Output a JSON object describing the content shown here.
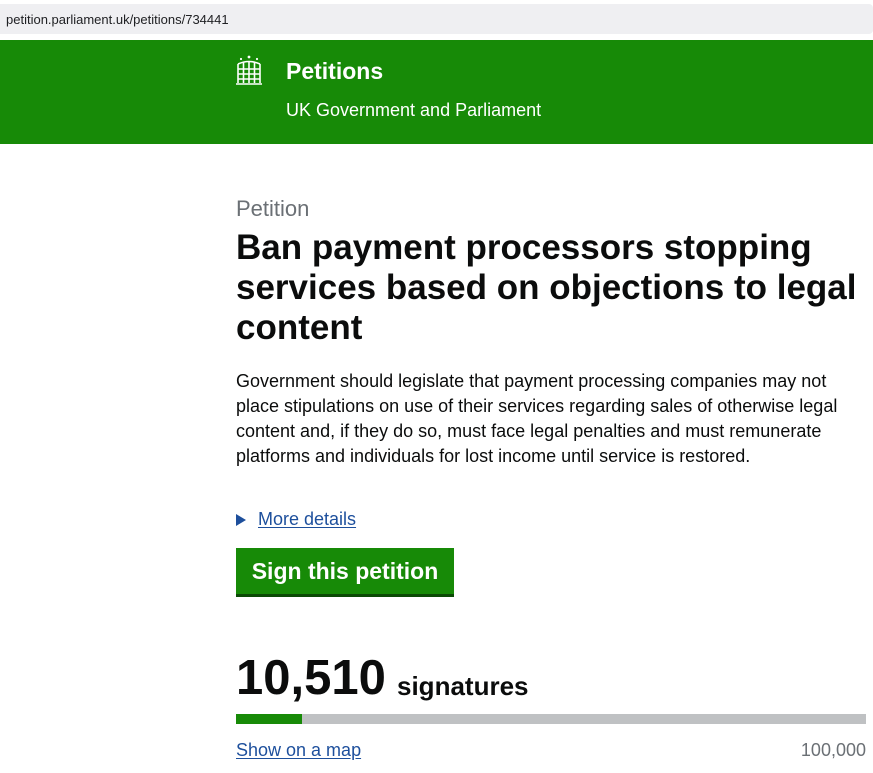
{
  "browser": {
    "url": "petition.parliament.uk/petitions/734441"
  },
  "header": {
    "site_name": "Petitions",
    "subtitle": "UK Government and Parliament",
    "logo_icon": "portcullis-icon",
    "background_color": "#178a07"
  },
  "petition": {
    "caption": "Petition",
    "title": "Ban payment processors stopping services based on objections to legal content",
    "description": "Government should legislate that payment processing companies may not place stipulations on use of their services regarding sales of otherwise legal content and, if they do so, must face legal penalties and must remunerate platforms and individuals for lost income until service is restored.",
    "more_details_label": "More details",
    "sign_button_label": "Sign this petition"
  },
  "signatures": {
    "count": "10,510",
    "label": "signatures",
    "progress_fraction": 0.1051,
    "map_link_label": "Show on a map",
    "target": "100,000"
  },
  "colors": {
    "brand_green": "#178a07",
    "link_blue": "#1d4f9c",
    "progress_track": "#bfc1c3"
  }
}
